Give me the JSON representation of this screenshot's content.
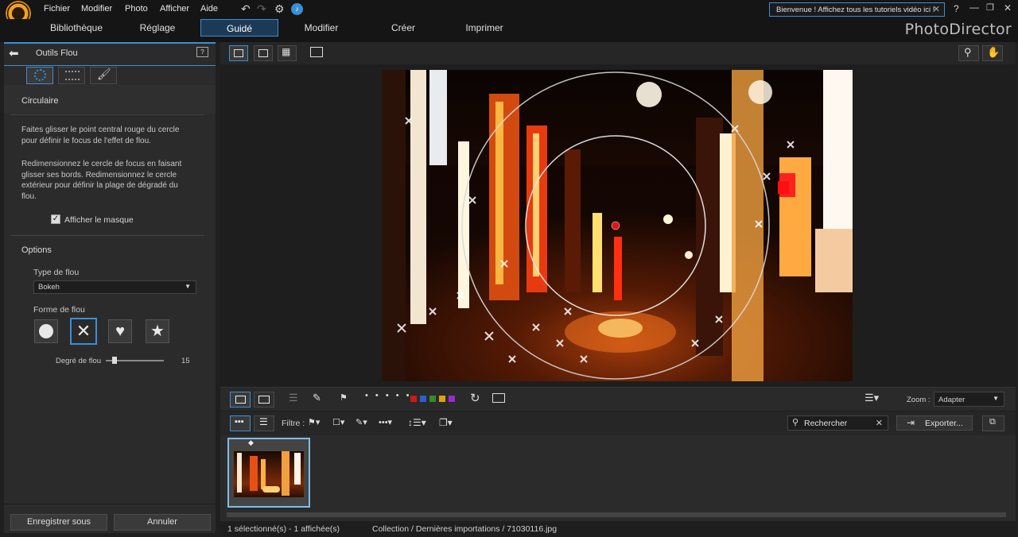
{
  "menu": [
    "Fichier",
    "Modifier",
    "Photo",
    "Afficher",
    "Aide"
  ],
  "notification": "Bienvenue ! Affichez tous les tutoriels vidéo ici !",
  "main_tabs": [
    "Bibliothèque",
    "Réglage",
    "Guidé",
    "Modifier",
    "Créer",
    "Imprimer"
  ],
  "active_tab": "Guidé",
  "brand": "PhotoDirector",
  "panel": {
    "title": "Outils Flou",
    "section_circular": "Circulaire",
    "desc1": "Faites glisser le point central rouge du cercle pour définir le focus de l'effet de flou.",
    "desc2": "Redimensionnez le cercle de focus en faisant glisser ses bords. Redimensionnez le cercle extérieur pour définir la plage de dégradé du flou.",
    "show_mask_label": "Afficher le masque",
    "show_mask_checked": true,
    "options_label": "Options",
    "blur_type_label": "Type de flou",
    "blur_type_value": "Bokeh",
    "blur_shape_label": "Forme de flou",
    "blur_shapes": [
      "circle",
      "cross",
      "heart",
      "star"
    ],
    "selected_shape": "cross",
    "blur_degree_label": "Degré de flou",
    "blur_degree_value": "15",
    "save_as": "Enregistrer sous",
    "cancel": "Annuler"
  },
  "toolbar": {
    "zoom_label": "Zoom :",
    "zoom_value": "Adapter",
    "filter_label": "Filtre :",
    "search_placeholder": "Rechercher",
    "export_label": "Exporter...",
    "color_labels": [
      "#d01818",
      "#2b5fd0",
      "#3a8a2a",
      "#e0a010",
      "#9a2ad0"
    ]
  },
  "status": {
    "selection": "1 sélectionné(s) - 1 affichée(s)",
    "path": "Collection / Dernières importations / 71030116.jpg"
  },
  "colors": {
    "accent": "#3a8fd6",
    "focus_point": "#e01515"
  }
}
